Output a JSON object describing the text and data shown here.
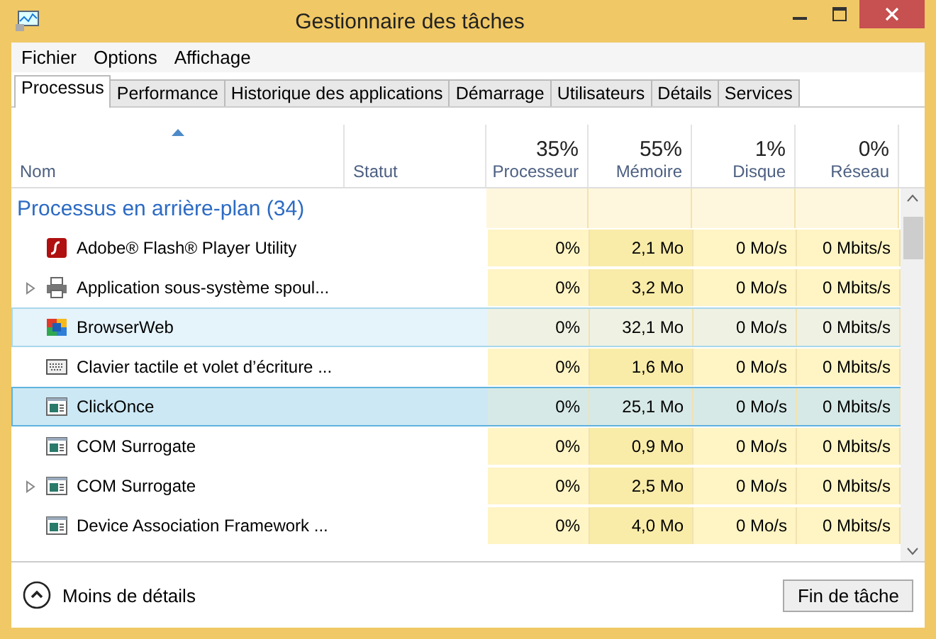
{
  "window": {
    "title": "Gestionnaire des tâches"
  },
  "menu": [
    "Fichier",
    "Options",
    "Affichage"
  ],
  "tabs": [
    {
      "label": "Processus",
      "selected": true
    },
    {
      "label": "Performance",
      "selected": false
    },
    {
      "label": "Historique des applications",
      "selected": false
    },
    {
      "label": "Démarrage",
      "selected": false
    },
    {
      "label": "Utilisateurs",
      "selected": false
    },
    {
      "label": "Détails",
      "selected": false
    },
    {
      "label": "Services",
      "selected": false
    }
  ],
  "columns": [
    {
      "label": "Nom"
    },
    {
      "label": "Statut"
    },
    {
      "label": "Processeur",
      "total": "35%"
    },
    {
      "label": "Mémoire",
      "total": "55%"
    },
    {
      "label": "Disque",
      "total": "1%"
    },
    {
      "label": "Réseau",
      "total": "0%"
    }
  ],
  "group": {
    "label": "Processus en arrière-plan (34)"
  },
  "rows": [
    {
      "name": "Adobe® Flash® Player Utility",
      "kind": "flash",
      "expandable": false,
      "selected": false,
      "hovered": false,
      "cpu": "0%",
      "memory": "2,1 Mo",
      "disk": "0 Mo/s",
      "network": "0 Mbits/s"
    },
    {
      "name": "Application sous-système spoul...",
      "kind": "printer",
      "expandable": true,
      "selected": false,
      "hovered": false,
      "cpu": "0%",
      "memory": "3,2 Mo",
      "disk": "0 Mo/s",
      "network": "0 Mbits/s"
    },
    {
      "name": "BrowserWeb",
      "kind": "browser",
      "expandable": false,
      "selected": false,
      "hovered": true,
      "cpu": "0%",
      "memory": "32,1 Mo",
      "disk": "0 Mo/s",
      "network": "0 Mbits/s"
    },
    {
      "name": "Clavier tactile et volet d’écriture ...",
      "kind": "keyboard",
      "expandable": false,
      "selected": false,
      "hovered": false,
      "cpu": "0%",
      "memory": "1,6 Mo",
      "disk": "0 Mo/s",
      "network": "0 Mbits/s"
    },
    {
      "name": "ClickOnce",
      "kind": "window",
      "expandable": false,
      "selected": true,
      "hovered": false,
      "cpu": "0%",
      "memory": "25,1 Mo",
      "disk": "0 Mo/s",
      "network": "0 Mbits/s"
    },
    {
      "name": "COM Surrogate",
      "kind": "window",
      "expandable": false,
      "selected": false,
      "hovered": false,
      "cpu": "0%",
      "memory": "0,9 Mo",
      "disk": "0 Mo/s",
      "network": "0 Mbits/s"
    },
    {
      "name": "COM Surrogate",
      "kind": "window",
      "expandable": true,
      "selected": false,
      "hovered": false,
      "cpu": "0%",
      "memory": "2,5 Mo",
      "disk": "0 Mo/s",
      "network": "0 Mbits/s"
    },
    {
      "name": "Device Association Framework ...",
      "kind": "window",
      "expandable": false,
      "selected": false,
      "hovered": false,
      "cpu": "0%",
      "memory": "4,0 Mo",
      "disk": "0 Mo/s",
      "network": "0 Mbits/s"
    }
  ],
  "footer": {
    "toggle": "Moins de détails",
    "button": "Fin de tâche"
  }
}
